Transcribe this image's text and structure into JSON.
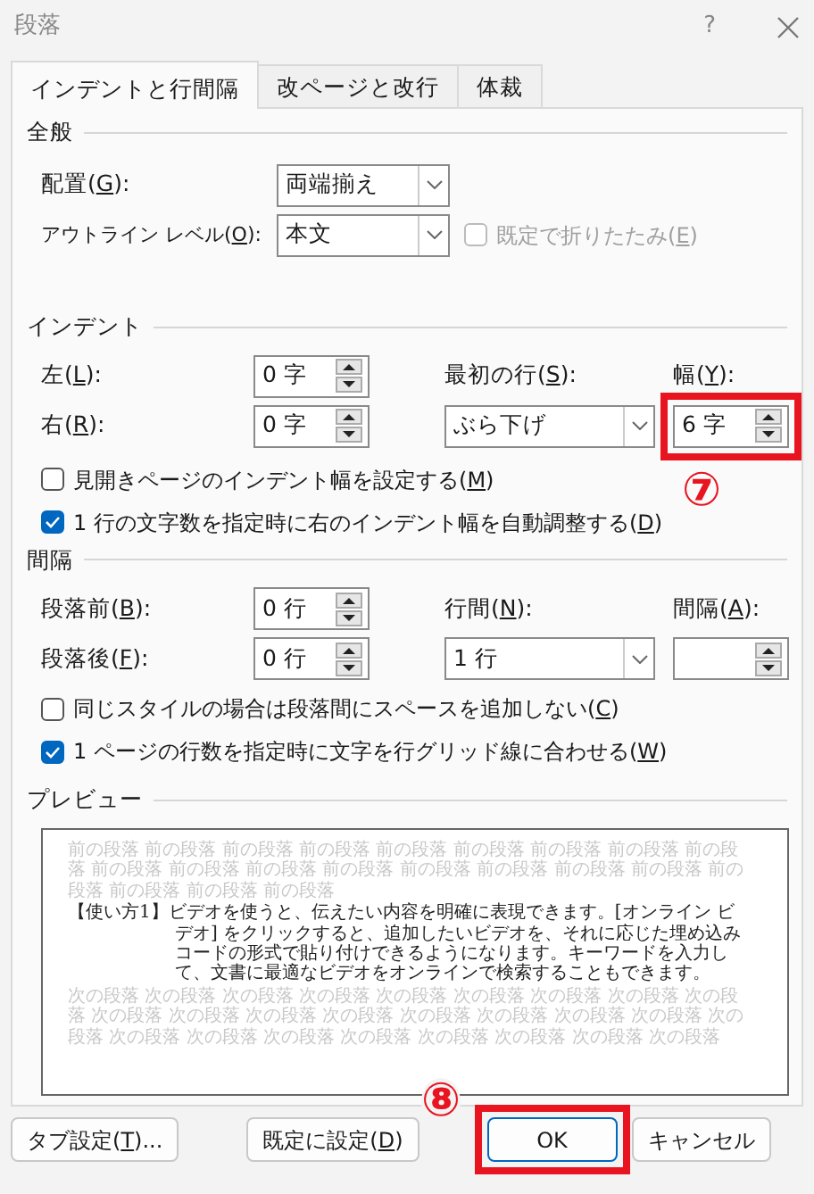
{
  "window": {
    "title": "段落",
    "help": "?"
  },
  "tabs": [
    {
      "label": "インデントと行間隔",
      "selected": true
    },
    {
      "label": "改ページと改行",
      "selected": false
    },
    {
      "label": "体裁",
      "selected": false
    }
  ],
  "general": {
    "heading": "全般",
    "alignment": {
      "label": "配置(G):",
      "value": "両端揃え"
    },
    "outline_level": {
      "label": "アウトライン レベル(O):",
      "value": "本文"
    },
    "collapse": {
      "label": "既定で折りたたみ(E)",
      "checked": false,
      "disabled": true
    }
  },
  "indent": {
    "heading": "インデント",
    "left": {
      "label": "左(L):",
      "value": "0 字"
    },
    "right": {
      "label": "右(R):",
      "value": "0 字"
    },
    "first_line": {
      "label": "最初の行(S):",
      "value": "ぶら下げ"
    },
    "by": {
      "label": "幅(Y):",
      "value": "6 字",
      "highlighted": true,
      "annotation": "⑦"
    },
    "options": [
      {
        "label": "見開きページのインデント幅を設定する(M)",
        "checked": false,
        "disabled": false
      },
      {
        "label": "1 行の文字数を指定時に右のインデント幅を自動調整する(D)",
        "checked": true,
        "disabled": false
      }
    ]
  },
  "spacing": {
    "heading": "間隔",
    "before": {
      "label": "段落前(B):",
      "value": "0 行"
    },
    "after": {
      "label": "段落後(F):",
      "value": "0 行"
    },
    "line_spacing": {
      "label": "行間(N):",
      "value": "1 行"
    },
    "at": {
      "label": "間隔(A):"
    },
    "options": [
      {
        "label": "同じスタイルの場合は段落間にスペースを追加しない(C)",
        "checked": false,
        "disabled": false
      },
      {
        "label": "1 ページの行数を指定時に文字を行グリッド線に合わせる(W)",
        "checked": true,
        "disabled": false
      }
    ]
  },
  "preview": {
    "heading": "プレビュー",
    "previous": "前の段落 前の段落 前の段落 前の段落 前の段落 前の段落 前の段落 前の段落 前の段落 前の段落 前の段落 前の段落 前の段落 前の段落 前の段落 前の段落 前の段落 前の段落 前の段落 前の段落 前の段落",
    "label": "【使い方1】",
    "body": "ビデオを使うと、伝えたい内容を明確に表現できます。[オンライン ビデオ] をクリックすると、追加したいビデオを、それに応じた埋め込みコードの形式で貼り付けできるようになります。キーワードを入力して、文書に最適なビデオをオンラインで検索することもできます。",
    "next": "次の段落 次の段落 次の段落 次の段落 次の段落 次の段落 次の段落 次の段落 次の段落 次の段落 次の段落 次の段落 次の段落 次の段落 次の段落 次の段落 次の段落 次の段落 次の段落 次の段落 次の段落 次の段落 次の段落 次の段落 次の段落 次の段落"
  },
  "buttons": [
    {
      "label": "タブ設定(T)...",
      "default": false
    },
    {
      "label": "既定に設定(D)",
      "default": false
    },
    {
      "label": "OK",
      "default": true,
      "highlighted": true,
      "annotation": "⑧"
    },
    {
      "label": "キャンセル",
      "default": false
    }
  ]
}
